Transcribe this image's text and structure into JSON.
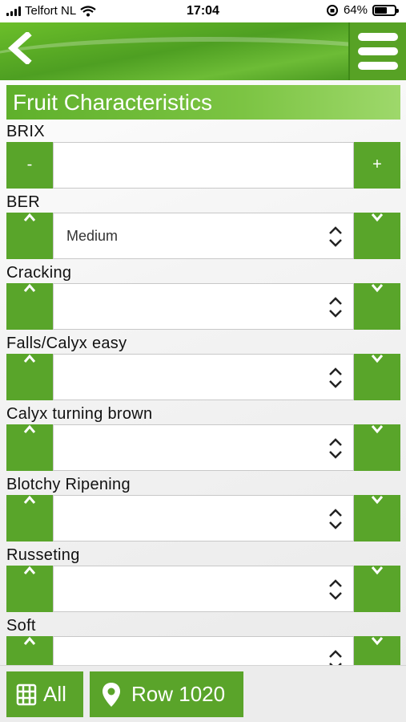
{
  "status": {
    "carrier": "Telfort NL",
    "time": "17:04",
    "battery": "64%",
    "battery_level": 0.64
  },
  "header": {
    "back_icon": "chevron-left-icon",
    "menu_icon": "hamburger-menu-icon"
  },
  "section_title": "Fruit Characteristics",
  "fields": [
    {
      "label": "BRIX",
      "type": "stepper",
      "value": "",
      "minus": "-",
      "plus": "+"
    },
    {
      "label": "BER",
      "type": "select",
      "value": "Medium"
    },
    {
      "label": "Cracking",
      "type": "select",
      "value": ""
    },
    {
      "label": "Falls/Calyx easy",
      "type": "select",
      "value": ""
    },
    {
      "label": "Calyx turning brown",
      "type": "select",
      "value": ""
    },
    {
      "label": "Blotchy Ripening",
      "type": "select",
      "value": ""
    },
    {
      "label": "Russeting",
      "type": "select",
      "value": ""
    },
    {
      "label": "Soft",
      "type": "select",
      "value": ""
    }
  ],
  "bottom": {
    "all_label": "All",
    "row_label": "Row 1020",
    "all_icon": "grid-icon",
    "row_icon": "map-pin-icon"
  }
}
